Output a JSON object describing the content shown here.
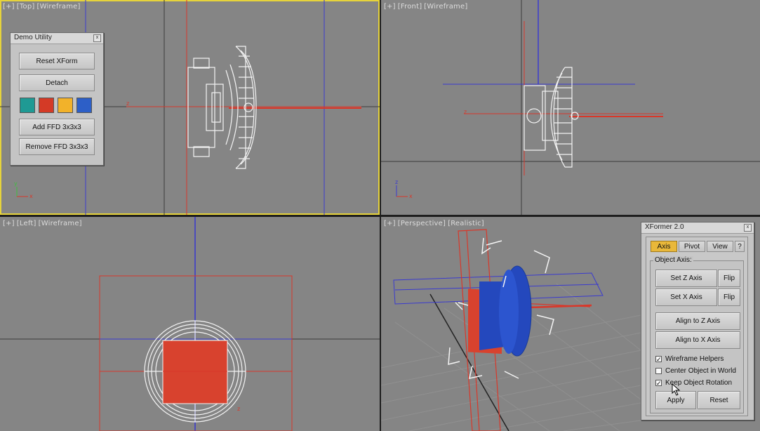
{
  "viewports": {
    "top": {
      "bracket": "[+]",
      "name": "[Top]",
      "mode": "[Wireframe]"
    },
    "front": {
      "bracket": "[+]",
      "name": "[Front]",
      "mode": "[Wireframe]"
    },
    "left": {
      "bracket": "[+]",
      "name": "[Left]",
      "mode": "[Wireframe]"
    },
    "perspective": {
      "bracket": "[+]",
      "name": "[Perspective]",
      "mode": "[Realistic]"
    }
  },
  "axis_labels": {
    "x": "x",
    "y": "y",
    "z": "z"
  },
  "demo_utility": {
    "title": "Demo Utility",
    "close": "x",
    "buttons": {
      "reset_xform": "Reset XForm",
      "detach": "Detach",
      "add_ffd": "Add FFD 3x3x3",
      "remove_ffd": "Remove FFD 3x3x3"
    },
    "swatches": [
      "#1f9a94",
      "#d43a26",
      "#f2b22a",
      "#2d5fc7"
    ]
  },
  "xformer": {
    "title": "XFormer 2.0",
    "close": "x",
    "tabs": [
      "Axis",
      "Pivot",
      "View",
      "?"
    ],
    "active_tab": "Axis",
    "group_label": "Object Axis:",
    "set_z": "Set Z Axis",
    "set_x": "Set X Axis",
    "flip": "Flip",
    "align_z": "Align to Z Axis",
    "align_x": "Align to X Axis",
    "checkboxes": [
      {
        "label": "Wireframe Helpers",
        "checked": true
      },
      {
        "label": "Center Object in World",
        "checked": false
      },
      {
        "label": "Keep Object Rotation",
        "checked": true
      }
    ],
    "apply": "Apply",
    "reset": "Reset"
  },
  "colors": {
    "viewport_bg": "#858585",
    "active_border": "#e6d33b",
    "accent_tab": "#e9b83a"
  }
}
